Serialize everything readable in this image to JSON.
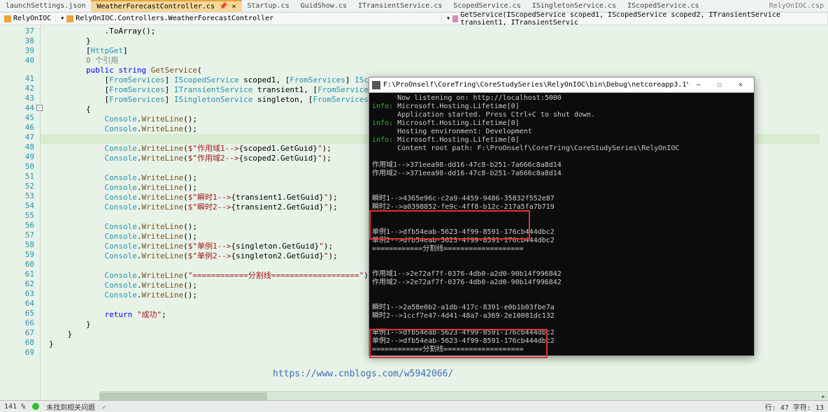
{
  "tabs": {
    "items": [
      {
        "label": "launchSettings.json"
      },
      {
        "label": "WeatherForecastController.cs",
        "active": true
      },
      {
        "label": "Startup.cs"
      },
      {
        "label": "GuidShow.cs"
      },
      {
        "label": "ITransientService.cs"
      },
      {
        "label": "ScopedService.cs"
      },
      {
        "label": "ISingletonService.cs"
      },
      {
        "label": "IScopedService.cs"
      }
    ],
    "right": "RelyOnIOC.csp"
  },
  "context": {
    "left": "RelyOnIOC",
    "mid": "RelyOnIOC.Controllers.WeatherForecastController",
    "right": "GetService(IScopedService scoped1, IScopedService scoped2, ITransientService transient1, ITransientServic"
  },
  "lines": [
    "37",
    "38",
    "39",
    "40",
    "41",
    "42",
    "43",
    "44",
    "45",
    "46",
    "47",
    "48",
    "49",
    "50",
    "51",
    "52",
    "53",
    "54",
    "55",
    "56",
    "57",
    "58",
    "59",
    "60",
    "61",
    "62",
    "63",
    "64",
    "65",
    "66",
    "67",
    "68",
    "69"
  ],
  "code": {
    "l37": ".ToArray();",
    "l38": "}",
    "l39a": "HttpGet",
    "l39b": "0 个引用",
    "l40a": "public",
    "l40b": "string",
    "l40c": "GetService",
    "l41": "[FromServices] IScopedService scoped1, [FromServices] IScopedService scoped2,",
    "l42": "[FromServices] ITransientService transient1, [FromServices] ITransient",
    "l43": "[FromServices] ISingletonService singleton, [FromServices] ISingleton",
    "l44": "{",
    "l45": "Console.WriteLine();",
    "l46": "Console.WriteLine();",
    "l48": "Console.WriteLine($\"作用域1-->{scoped1.GetGuid}\");",
    "l49": "Console.WriteLine($\"作用域2-->{scoped2.GetGuid}\");",
    "l51": "Console.WriteLine();",
    "l52": "Console.WriteLine();",
    "l53": "Console.WriteLine($\"瞬时1-->{transient1.GetGuid}\");",
    "l54": "Console.WriteLine($\"瞬时2-->{transient2.GetGuid}\");",
    "l56": "Console.WriteLine();",
    "l57": "Console.WriteLine();",
    "l58": "Console.WriteLine($\"单例1-->{singleton.GetGuid}\");",
    "l59": "Console.WriteLine($\"单例2-->{singleton2.GetGuid}\");",
    "l61": "Console.WriteLine(\"============分割线===================\");",
    "l62": "Console.WriteLine();",
    "l63": "Console.WriteLine();",
    "l65a": "return",
    "l65b": "\"成功\"",
    "l66": "}",
    "l67": "}",
    "l68": "}"
  },
  "watermark": "https://www.cnblogs.com/w5942066/",
  "console": {
    "title": "F:\\ProOnself\\CoreTring\\CoreStudySeries\\RelyOnIOC\\bin\\Debug\\netcoreapp3.1\\RelyOnIOC.exe",
    "lines": [
      {
        "p": "",
        "t": "      Now listening on: http://localhost:5000"
      },
      {
        "p": "info:",
        "t": " Microsoft.Hosting.Lifetime[0]"
      },
      {
        "p": "",
        "t": "      Application started. Press Ctrl+C to shut down."
      },
      {
        "p": "info:",
        "t": " Microsoft.Hosting.Lifetime[0]"
      },
      {
        "p": "",
        "t": "      Hosting environment: Development"
      },
      {
        "p": "info:",
        "t": " Microsoft.Hosting.Lifetime[0]"
      },
      {
        "p": "",
        "t": "      Content root path: F:\\ProOnself\\CoreTring\\CoreStudySeries\\RelyOnIOC"
      },
      {
        "p": "",
        "t": ""
      },
      {
        "p": "",
        "t": "作用域1-->371eea98-dd16-47c8-b251-7a666c8a8d14"
      },
      {
        "p": "",
        "t": "作用域2-->371eea98-dd16-47c8-b251-7a666c8a8d14"
      },
      {
        "p": "",
        "t": ""
      },
      {
        "p": "",
        "t": ""
      },
      {
        "p": "",
        "t": "瞬时1-->4365e96c-c2a9-4459-9486-35832f552e87"
      },
      {
        "p": "",
        "t": "瞬时2-->a0398852-fe9c-4ff8-b12c-217a5fa7b719"
      },
      {
        "p": "",
        "t": ""
      },
      {
        "p": "",
        "t": ""
      },
      {
        "p": "",
        "t": "单例1-->dfb54eab-5623-4f99-8591-176cb444dbc2"
      },
      {
        "p": "",
        "t": "单例2-->dfb54eab-5623-4f99-8591-176cb444dbc2"
      },
      {
        "p": "",
        "t": "============分割线==================="
      },
      {
        "p": "",
        "t": ""
      },
      {
        "p": "",
        "t": ""
      },
      {
        "p": "",
        "t": "作用域1-->2e72af7f-0376-4db0-a2d0-90b14f996842"
      },
      {
        "p": "",
        "t": "作用域2-->2e72af7f-0376-4db0-a2d0-90b14f996842"
      },
      {
        "p": "",
        "t": ""
      },
      {
        "p": "",
        "t": ""
      },
      {
        "p": "",
        "t": "瞬时1-->2a58e0b2-a1db-417c-8391-e0b1b03fbe7a"
      },
      {
        "p": "",
        "t": "瞬时2-->1ccf7e47-4d41-48a7-a369-2e10081dc132"
      },
      {
        "p": "",
        "t": ""
      },
      {
        "p": "",
        "t": "单例1-->dfb54eab-5623-4f99-8591-176cb444dbc2"
      },
      {
        "p": "",
        "t": "单例2-->dfb54eab-5623-4f99-8591-176cb444dbc2"
      },
      {
        "p": "",
        "t": "============分割线==================="
      }
    ],
    "wbtn_min": "—",
    "wbtn_max": "☐",
    "wbtn_close": "✕"
  },
  "status": {
    "zoom": "141 %",
    "issues": "未找到相关问题",
    "pos": "行: 47  字符: 13"
  }
}
